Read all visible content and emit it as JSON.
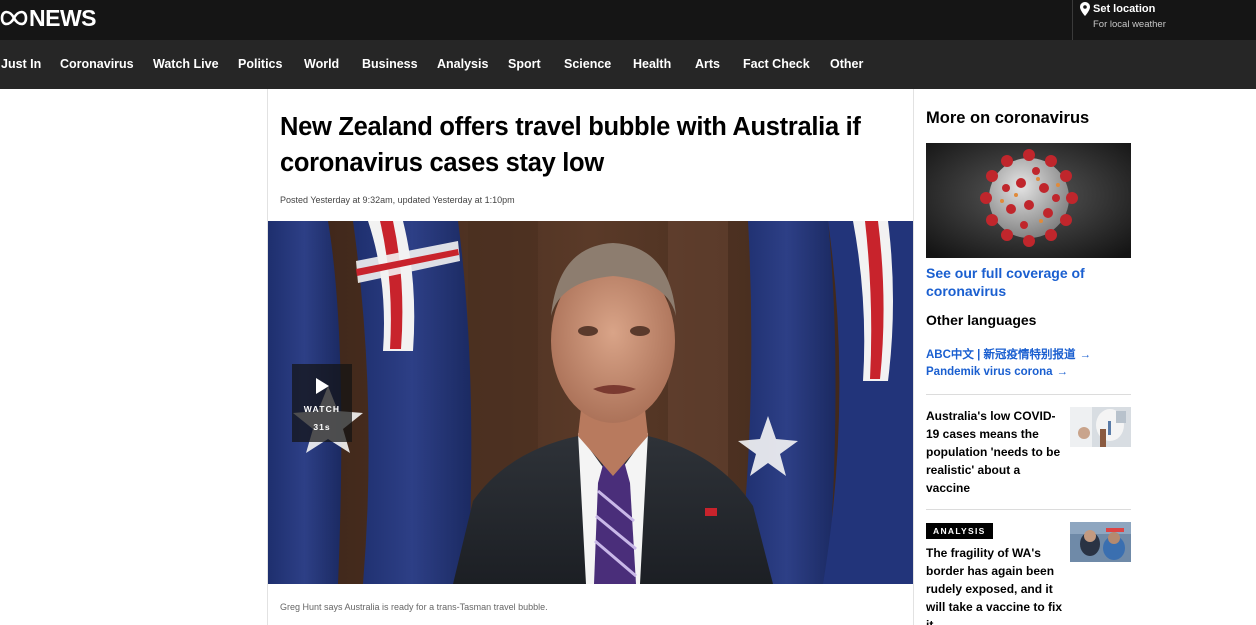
{
  "brand": {
    "logo_text": "NEWS",
    "location_title": "Set location",
    "location_subtitle": "For local weather"
  },
  "nav": {
    "items": [
      {
        "label": "Just In"
      },
      {
        "label": "Coronavirus"
      },
      {
        "label": "Watch Live"
      },
      {
        "label": "Politics"
      },
      {
        "label": "World"
      },
      {
        "label": "Business"
      },
      {
        "label": "Analysis"
      },
      {
        "label": "Sport"
      },
      {
        "label": "Science"
      },
      {
        "label": "Health"
      },
      {
        "label": "Arts"
      },
      {
        "label": "Fact Check"
      },
      {
        "label": "Other"
      }
    ]
  },
  "article": {
    "headline": "New Zealand offers travel bubble with Australia if coronavirus cases stay low",
    "meta": "Posted Yesterday at 9:32am, updated Yesterday at 1:10pm",
    "video": {
      "watch_label": "WATCH",
      "duration": "31s"
    },
    "caption": "Greg Hunt says Australia is ready for a trans-Tasman travel bubble."
  },
  "sidebar": {
    "title": "More on coronavirus",
    "coverage_link": "See our full coverage of coronavirus",
    "languages_title": "Other languages",
    "languages": [
      {
        "label": "ABC中文 | 新冠疫情特别报道",
        "arrow": "→"
      },
      {
        "label": "Pandemik virus corona",
        "arrow": "→"
      }
    ],
    "stories": [
      {
        "text": "Australia's low COVID-19 cases means the population 'needs to be realistic' about a vaccine"
      },
      {
        "badge": "ANALYSIS",
        "text": "The fragility of WA's border has again been rudely exposed, and it will take a vaccine to fix it"
      }
    ]
  },
  "colors": {
    "topbar": "#151515",
    "navbar": "#262626",
    "link_blue": "#1a5fd0"
  }
}
